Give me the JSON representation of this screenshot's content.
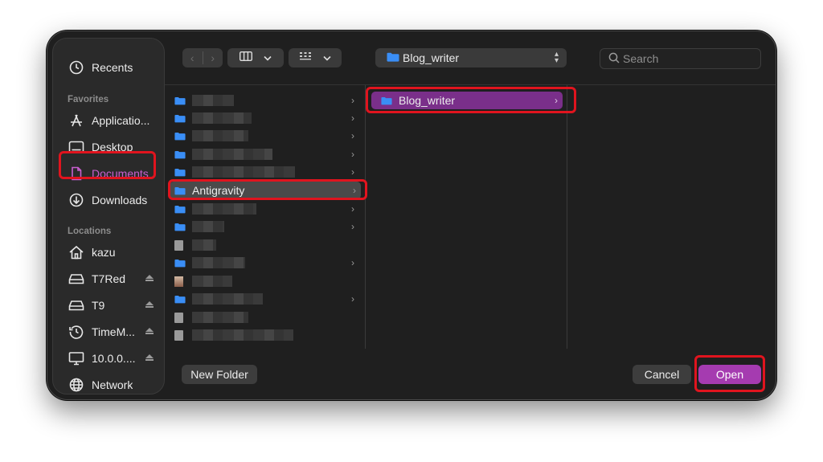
{
  "sidebar": {
    "recents_label": "Recents",
    "favorites_header": "Favorites",
    "favorites": [
      {
        "label": "Applicatio...",
        "icon": "applications-icon"
      },
      {
        "label": "Desktop",
        "icon": "desktop-icon"
      },
      {
        "label": "Documents",
        "icon": "document-icon",
        "selected": true
      },
      {
        "label": "Downloads",
        "icon": "downloads-icon"
      }
    ],
    "locations_header": "Locations",
    "locations": [
      {
        "label": "kazu",
        "icon": "home-icon"
      },
      {
        "label": "T7Red",
        "icon": "drive-icon",
        "eject": true
      },
      {
        "label": "T9",
        "icon": "drive-icon",
        "eject": true
      },
      {
        "label": "TimeM...",
        "icon": "time-machine-icon",
        "eject": true
      },
      {
        "label": "10.0.0....",
        "icon": "monitor-icon",
        "eject": true
      },
      {
        "label": "Network",
        "icon": "globe-icon"
      }
    ]
  },
  "toolbar": {
    "path_popup": "Blog_writer",
    "search_placeholder": "Search"
  },
  "browser": {
    "column1_selected": "Antigravity",
    "column2_items": [
      "Blog_writer"
    ]
  },
  "footer": {
    "new_folder": "New Folder",
    "cancel": "Cancel",
    "open": "Open"
  },
  "colors": {
    "accent": "#a53bb0",
    "selection_purple": "#7a2f8a",
    "highlight_red": "#e0141e"
  }
}
